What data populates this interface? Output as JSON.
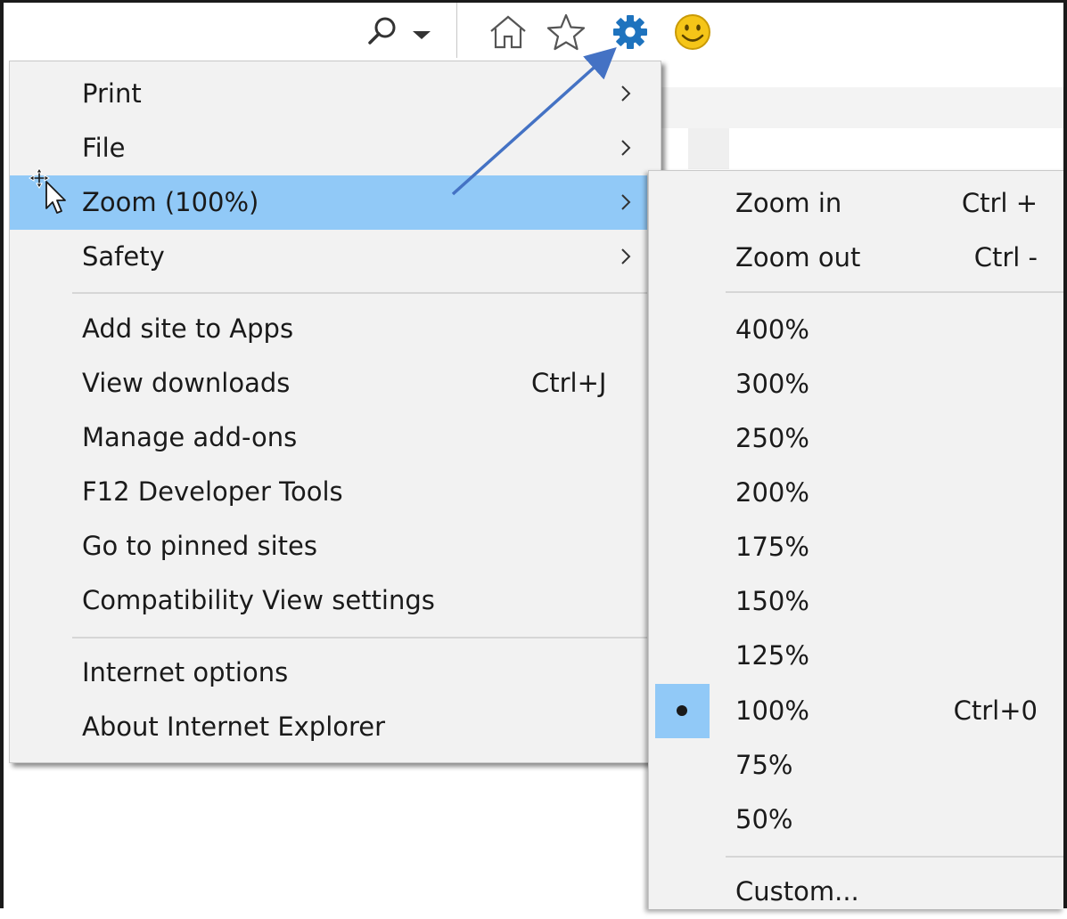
{
  "toolbar": {
    "icons": [
      "search-icon",
      "chevron-down-icon",
      "home-icon",
      "star-icon",
      "gear-icon",
      "smiley-icon"
    ]
  },
  "main_menu": {
    "items": [
      {
        "label": "Print",
        "submenu": true
      },
      {
        "label": "File",
        "submenu": true
      },
      {
        "label": "Zoom (100%)",
        "submenu": true,
        "highlighted": true
      },
      {
        "label": "Safety",
        "submenu": true
      },
      {
        "label": "Add site to Apps"
      },
      {
        "label": "View downloads",
        "shortcut": "Ctrl+J"
      },
      {
        "label": "Manage add-ons"
      },
      {
        "label": "F12 Developer Tools"
      },
      {
        "label": "Go to pinned sites"
      },
      {
        "label": "Compatibility View settings"
      },
      {
        "label": "Internet options"
      },
      {
        "label": "About Internet Explorer"
      }
    ]
  },
  "zoom_menu": {
    "items": [
      {
        "label": "Zoom in",
        "shortcut": "Ctrl +"
      },
      {
        "label": "Zoom out",
        "shortcut": "Ctrl -"
      },
      {
        "label": "400%"
      },
      {
        "label": "300%"
      },
      {
        "label": "250%"
      },
      {
        "label": "200%"
      },
      {
        "label": "175%"
      },
      {
        "label": "150%"
      },
      {
        "label": "125%"
      },
      {
        "label": "100%",
        "shortcut": "Ctrl+0",
        "selected": true
      },
      {
        "label": "75%"
      },
      {
        "label": "50%"
      },
      {
        "label": "Custom..."
      }
    ]
  },
  "colors": {
    "highlight": "#91c9f7",
    "menu_bg": "#f2f2f2",
    "gear": "#1e73be",
    "smiley": "#f5c518",
    "annotation_arrow": "#4472c4"
  }
}
